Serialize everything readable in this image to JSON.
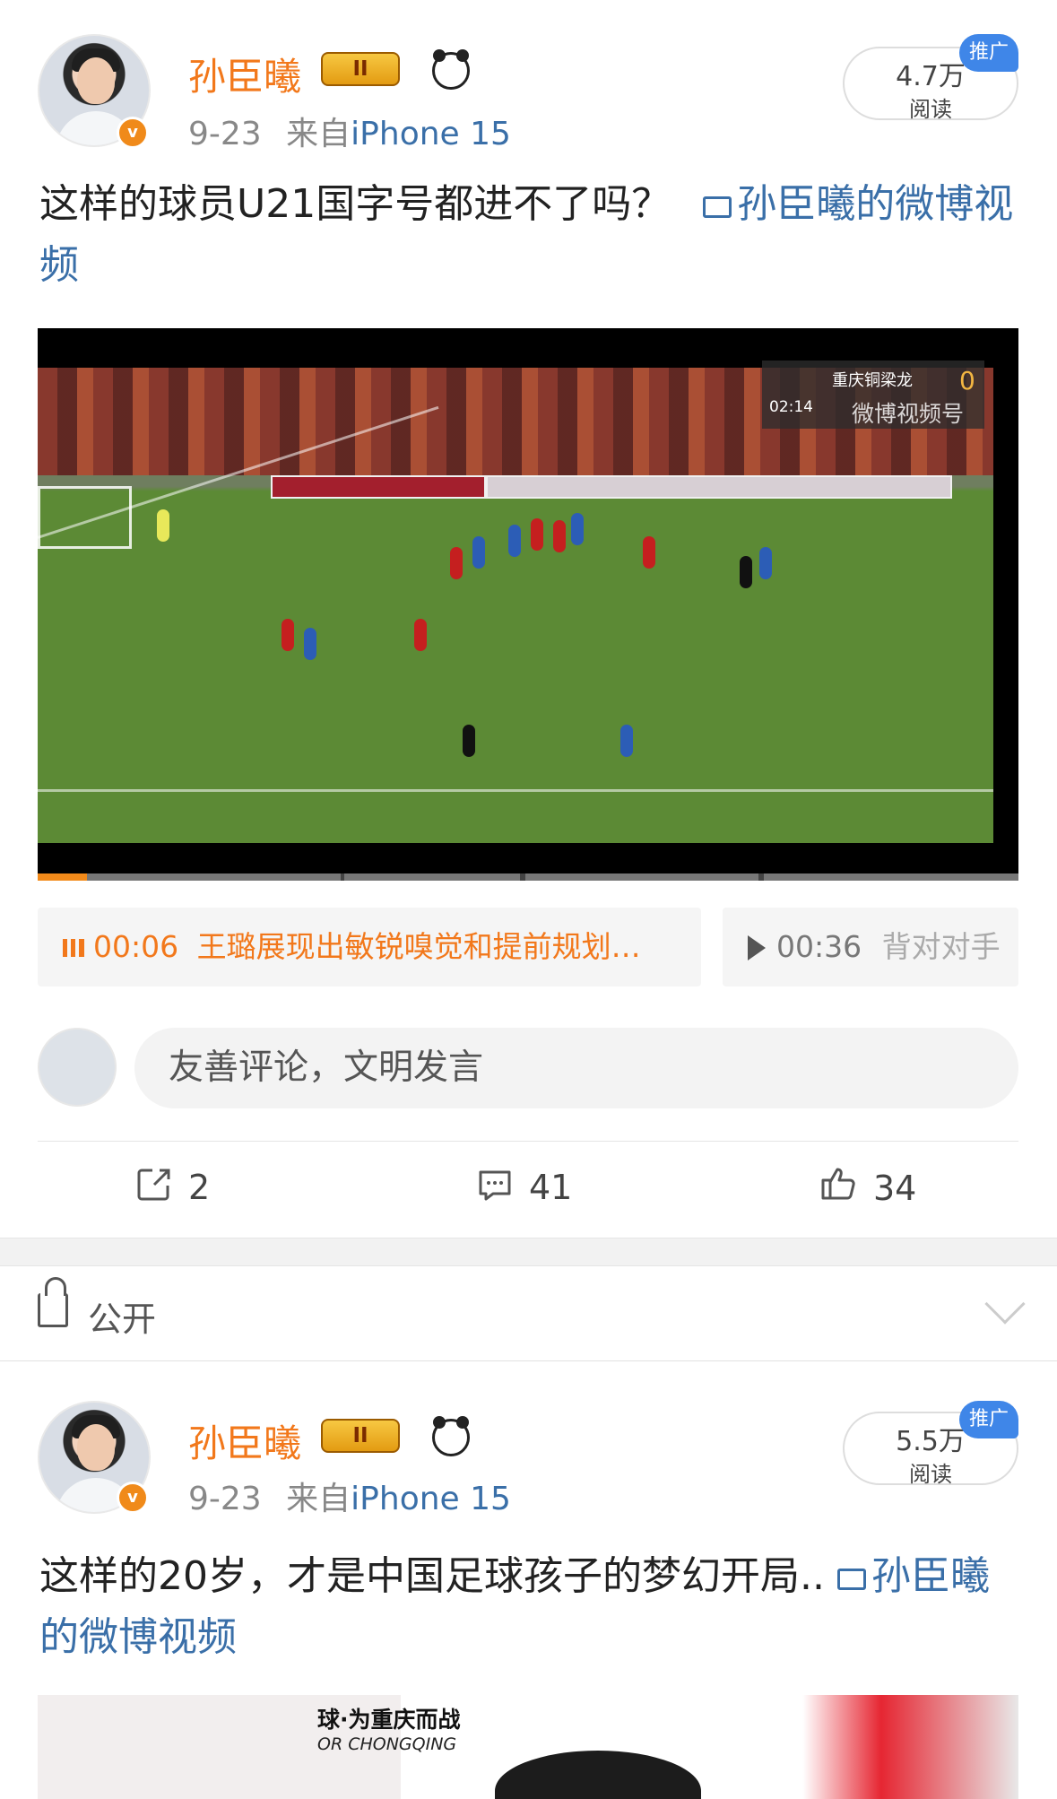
{
  "post1": {
    "author": "孙臣曦",
    "level_badge": "II",
    "date": "9-23",
    "source_prefix": "来自",
    "device": "iPhone 15",
    "reads": "4.7万",
    "reads_label": "阅读",
    "promo": "推广",
    "text": "这样的球员U21国字号都进不了吗？",
    "video_link": "孙臣曦的微博视频",
    "video": {
      "scoreboard_team": "重庆铜梁龙",
      "scoreboard_score": "0",
      "time": "02:14",
      "watermark": "微博视频号",
      "progress": 0.05
    },
    "chapters": [
      {
        "time": "00:06",
        "title": "王璐展现出敏锐嗅觉和提前规划…",
        "active": true
      },
      {
        "time": "00:36",
        "title": "背对对手",
        "active": false
      }
    ],
    "comment_placeholder": "友善评论，文明发言",
    "actions": [
      {
        "name": "repost",
        "icon": "share-icon",
        "count": "2"
      },
      {
        "name": "comment",
        "icon": "comment-icon",
        "count": "41"
      },
      {
        "name": "like",
        "icon": "thumbs-up-icon",
        "count": "34"
      }
    ]
  },
  "visibility": {
    "label": "公开"
  },
  "post2": {
    "author": "孙臣曦",
    "level_badge": "II",
    "date": "9-23",
    "source_prefix": "来自",
    "device": "iPhone 15",
    "reads": "5.5万",
    "reads_label": "阅读",
    "promo": "推广",
    "text": "这样的20岁，才是中国足球孩子的梦幻开局..",
    "video_link": "孙臣曦的微博视频",
    "thumb_title": "球·为重庆而战",
    "thumb_subtitle": "OR CHONGQING"
  },
  "colors": {
    "name_orange": "#f2781b",
    "link_blue": "#3a6fa8",
    "promo_blue": "#3f86e8",
    "progress_orange": "#f28a1a"
  }
}
